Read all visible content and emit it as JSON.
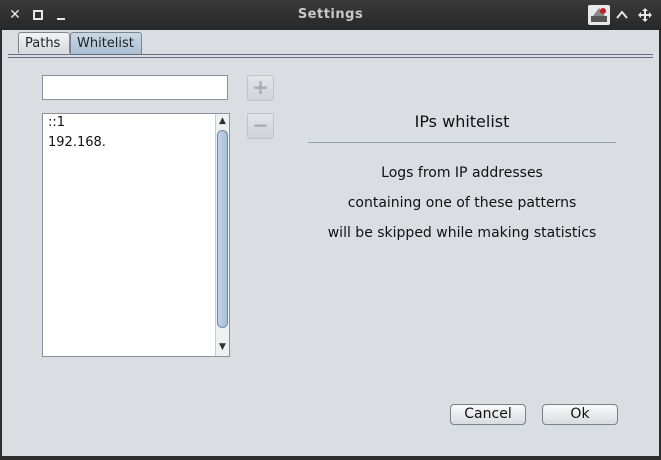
{
  "window": {
    "title": "Settings",
    "controls": {
      "close": "✕",
      "maximize": "□",
      "minimize": "▁",
      "shade": "⌃",
      "pin": "✥"
    }
  },
  "tabs": [
    {
      "label": "Paths",
      "active": false
    },
    {
      "label": "Whitelist",
      "active": true
    }
  ],
  "whitelist": {
    "input_value": "",
    "add_label": "+",
    "remove_label": "−",
    "items": [
      "::1",
      "192.168."
    ]
  },
  "info": {
    "title": "IPs whitelist",
    "lines": [
      "Logs from IP addresses",
      "containing one of these patterns",
      "will be skipped while making statistics"
    ]
  },
  "buttons": {
    "cancel": "Cancel",
    "ok": "Ok"
  },
  "colors": {
    "titlebar": "#2d2d2d",
    "client_bg": "#dadde2",
    "active_tab": "#b3c6d8"
  }
}
